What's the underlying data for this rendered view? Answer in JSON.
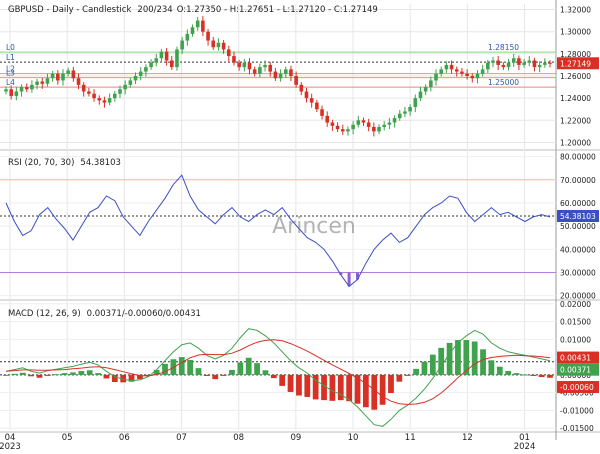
{
  "chart_data": [
    {
      "type": "candlestick",
      "panel": "price",
      "header": "GBPUSD - Daily - Candlestick",
      "header_counts": "200/234",
      "ohlc_text": "O:1.27350 - H:1.27651 - L:1.27120 - C:1.27149",
      "yticks": [
        "1.20000",
        "1.22000",
        "1.24000",
        "1.26000",
        "1.28000",
        "1.30000",
        "1.32000"
      ],
      "ylim": [
        1.195,
        1.325
      ],
      "last_close": 1.27149,
      "last_label": "1.27149",
      "levels": [
        {
          "name": "L0",
          "value": 1.2815,
          "label": "1.28150",
          "color": "#7ed67e"
        },
        {
          "name": "L1",
          "value": 1.2725,
          "label": "",
          "color": "#333333"
        },
        {
          "name": "L2",
          "value": 1.2622,
          "label": "",
          "color": "#e8a23c"
        },
        {
          "name": "L3",
          "value": 1.2585,
          "label": "",
          "color": "#e8a23c"
        },
        {
          "name": "L4",
          "value": 1.25,
          "label": "1.25000",
          "color": "#e8887a"
        }
      ],
      "series": [
        {
          "date": "2023-04",
          "close_path": [
            1.248,
            1.242,
            1.246,
            1.25,
            1.248,
            1.252,
            1.255,
            1.253,
            1.258,
            1.262,
            1.256
          ]
        },
        {
          "date": "2023-05",
          "close_path": [
            1.262,
            1.265,
            1.258,
            1.252,
            1.246,
            1.244,
            1.24,
            1.238,
            1.236,
            1.24,
            1.244
          ]
        },
        {
          "date": "2023-06",
          "close_path": [
            1.248,
            1.252,
            1.256,
            1.26,
            1.264,
            1.268,
            1.272,
            1.276,
            1.282,
            1.274,
            1.268
          ]
        },
        {
          "date": "2023-07",
          "close_path": [
            1.284,
            1.292,
            1.298,
            1.304,
            1.31,
            1.3,
            1.292,
            1.286,
            1.29,
            1.284,
            1.278
          ]
        },
        {
          "date": "2023-08",
          "close_path": [
            1.272,
            1.268,
            1.272,
            1.266,
            1.262,
            1.268,
            1.27,
            1.264,
            1.258,
            1.262,
            1.266
          ]
        },
        {
          "date": "2023-09",
          "close_path": [
            1.26,
            1.252,
            1.246,
            1.24,
            1.236,
            1.23,
            1.224,
            1.218,
            1.215,
            1.212,
            1.21
          ]
        },
        {
          "date": "2023-10",
          "close_path": [
            1.212,
            1.216,
            1.22,
            1.218,
            1.214,
            1.21,
            1.214,
            1.216,
            1.218,
            1.222,
            1.226
          ]
        },
        {
          "date": "2023-11",
          "close_path": [
            1.228,
            1.232,
            1.24,
            1.246,
            1.25,
            1.256,
            1.262,
            1.266,
            1.27,
            1.266,
            1.264
          ]
        },
        {
          "date": "2023-12",
          "close_path": [
            1.262,
            1.26,
            1.258,
            1.262,
            1.266,
            1.272,
            1.274,
            1.27,
            1.268,
            1.272,
            1.276
          ]
        },
        {
          "date": "2024-01",
          "close_path": [
            1.27,
            1.272,
            1.274,
            1.268,
            1.27,
            1.272,
            1.271
          ]
        }
      ]
    },
    {
      "type": "line",
      "panel": "rsi",
      "header": "RSI (20, 70, 30)",
      "value_text": "54.38103",
      "yticks": [
        "20.00000",
        "30.00000",
        "40.00000",
        "50.00000",
        "60.00000",
        "70.00000",
        "80.00000"
      ],
      "ylim": [
        19,
        82
      ],
      "overbought": 70,
      "oversold": 30,
      "last_value": 54.38103,
      "last_label": "54.38103",
      "values": [
        60,
        52,
        46,
        48,
        55,
        58,
        53,
        49,
        44,
        50,
        56,
        58,
        63,
        61,
        54,
        50,
        46,
        52,
        57,
        62,
        68,
        72,
        63,
        57,
        54,
        51,
        55,
        58,
        54,
        52,
        55,
        57,
        55,
        58,
        53,
        49,
        45,
        43,
        40,
        35,
        29,
        24,
        27,
        34,
        40,
        44,
        47,
        43,
        45,
        50,
        55,
        58,
        60,
        63,
        62,
        56,
        52,
        55,
        58,
        55,
        56,
        54,
        52,
        54,
        55,
        54
      ]
    },
    {
      "type": "bar+line",
      "panel": "macd",
      "header": "MACD (12, 26, 9)",
      "value_text": "0.00371/-0.00060/0.00431",
      "yticks": [
        "-0.01500",
        "-0.01000",
        "-0.00500",
        "0.00000",
        "0.00500",
        "0.01000",
        "0.01500",
        "0.02000"
      ],
      "ylim": [
        -0.0155,
        0.0205
      ],
      "zero_line": 0.0,
      "signal_line_level": 0.0037,
      "labels": [
        {
          "text": "0.00431",
          "value": 0.00431,
          "color": "#d93025"
        },
        {
          "text": "0.00371",
          "value": 0.00371,
          "color": "#3fa34d"
        },
        {
          "text": "-0.00060",
          "value": -0.0006,
          "color": "#d93025"
        }
      ],
      "macd": [
        0.001,
        0.0015,
        0.002,
        0.001,
        0.0005,
        0.0012,
        0.0016,
        0.002,
        0.0024,
        0.003,
        0.0035,
        0.0028,
        0.001,
        -0.0005,
        -0.0012,
        -0.0016,
        -0.0014,
        -0.0005,
        0.0015,
        0.004,
        0.0065,
        0.0085,
        0.009,
        0.0075,
        0.0055,
        0.0045,
        0.0055,
        0.0075,
        0.0105,
        0.013,
        0.0125,
        0.011,
        0.009,
        0.0065,
        0.004,
        0.002,
        0.0005,
        -0.0015,
        -0.003,
        -0.0045,
        -0.0055,
        -0.007,
        -0.009,
        -0.0115,
        -0.014,
        -0.0145,
        -0.0125,
        -0.01,
        -0.0085,
        -0.0065,
        -0.004,
        -0.001,
        0.0025,
        0.006,
        0.009,
        0.011,
        0.0125,
        0.0115,
        0.009,
        0.0075,
        0.0065,
        0.006,
        0.0055,
        0.005,
        0.0045,
        0.004
      ],
      "signal": [
        0.001,
        0.0012,
        0.0014,
        0.0014,
        0.0013,
        0.0013,
        0.0014,
        0.0015,
        0.0017,
        0.0019,
        0.0022,
        0.0023,
        0.002,
        0.0015,
        0.0009,
        0.0003,
        -0.0002,
        -0.0003,
        0.0001,
        0.0009,
        0.0021,
        0.0035,
        0.0048,
        0.0056,
        0.0058,
        0.0057,
        0.0057,
        0.0061,
        0.007,
        0.0082,
        0.0092,
        0.0097,
        0.0099,
        0.0096,
        0.0088,
        0.0078,
        0.0067,
        0.0054,
        0.0041,
        0.0028,
        0.0016,
        0.0004,
        -0.0009,
        -0.0024,
        -0.0042,
        -0.0061,
        -0.0074,
        -0.0081,
        -0.0083,
        -0.0082,
        -0.0077,
        -0.0067,
        -0.0051,
        -0.003,
        -0.0008,
        0.0012,
        0.0031,
        0.0043,
        0.0049,
        0.0052,
        0.0054,
        0.0055,
        0.0054,
        0.0053,
        0.0051,
        0.0048
      ]
    }
  ],
  "xaxis": {
    "labels": [
      {
        "text": "04",
        "sub": "2023"
      },
      {
        "text": "05",
        "sub": ""
      },
      {
        "text": "06",
        "sub": ""
      },
      {
        "text": "07",
        "sub": ""
      },
      {
        "text": "08",
        "sub": ""
      },
      {
        "text": "09",
        "sub": ""
      },
      {
        "text": "10",
        "sub": ""
      },
      {
        "text": "11",
        "sub": ""
      },
      {
        "text": "12",
        "sub": ""
      },
      {
        "text": "01",
        "sub": "2024"
      }
    ]
  },
  "watermark": "Arincen",
  "colors": {
    "up": "#3fa34d",
    "down": "#d93025",
    "rsi_line": "#3b4fc4",
    "rsi_70": "#e8c87a",
    "rsi_30": "#b57be0",
    "rsi_fill": "#8e5fd0",
    "macd_line": "#3fa34d",
    "signal_line": "#d93025",
    "last_price_bg": "#d93025",
    "last_rsi_bg": "#3b4fc4"
  }
}
